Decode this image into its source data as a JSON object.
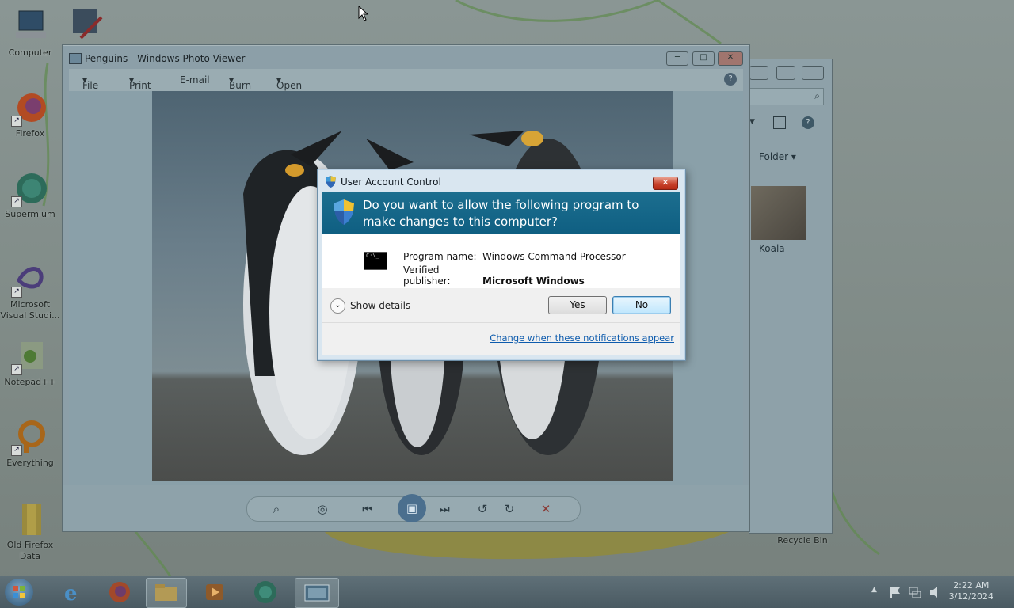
{
  "desktop": {
    "icons": [
      {
        "label": "Computer"
      },
      {
        "label": "Firefox"
      },
      {
        "label": "Supermium"
      },
      {
        "label": "Microsoft Visual Studi..."
      },
      {
        "label": "Notepad++"
      },
      {
        "label": "Everything"
      },
      {
        "label": "Old Firefox Data"
      },
      {
        "label": "Recycle Bin"
      }
    ],
    "right_items": [
      {
        "label": "Koala"
      }
    ]
  },
  "photo_viewer": {
    "title": "Penguins - Windows Photo Viewer",
    "menu": [
      "File",
      "Print",
      "E-mail",
      "Burn",
      "Open"
    ],
    "help": "?",
    "buttons": {
      "minimize": "─",
      "maximize": "□",
      "close": "✕"
    }
  },
  "explorer": {
    "toolbar_label": "Folder",
    "help": "?"
  },
  "uac": {
    "title": "User Account Control",
    "question": "Do you want to allow the following program to make changes to this computer?",
    "program_name_label": "Program name:",
    "program_name": "Windows Command Processor",
    "publisher_label": "Verified publisher:",
    "publisher": "Microsoft Windows",
    "cmd_glyph": "C:\\_",
    "show_details": "Show details",
    "yes": "Yes",
    "no": "No",
    "change_link": "Change when these notifications appear",
    "close_glyph": "✕"
  },
  "taskbar": {
    "time": "2:22 AM",
    "date": "3/12/2024",
    "up_glyph": "▲"
  }
}
